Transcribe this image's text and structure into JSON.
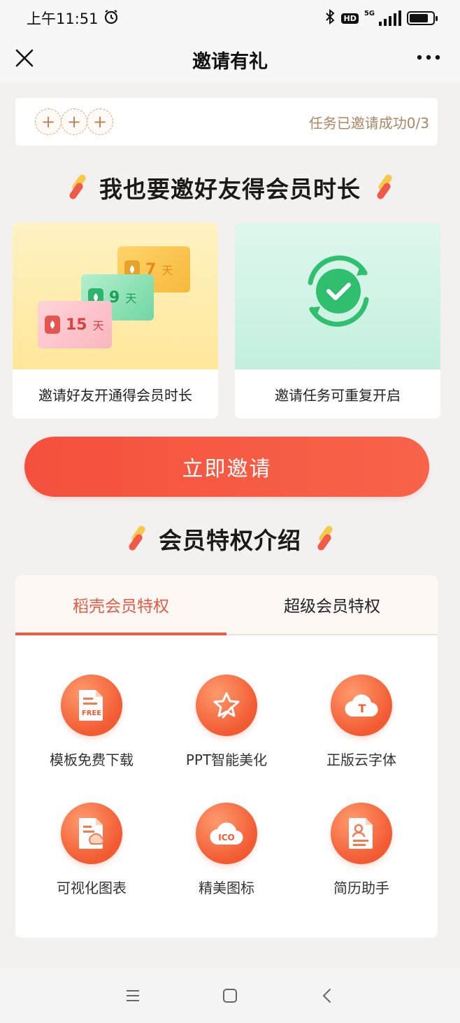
{
  "status_bar": {
    "time": "上午11:51",
    "hd": "HD",
    "network": "5G",
    "battery_level": 0.8
  },
  "nav": {
    "title": "邀请有礼"
  },
  "invite_progress": {
    "slot_symbol": "+",
    "slot_count": 3,
    "text": "任务已邀请成功0/3"
  },
  "section1": {
    "title": "我也要邀好友得会员时长"
  },
  "cards": [
    {
      "caption": "邀请好友开通得会员时长",
      "tickets": [
        {
          "num": "7",
          "unit": "天",
          "color": "#f6b93c"
        },
        {
          "num": "9",
          "unit": "天",
          "color": "#6fd6a2"
        },
        {
          "num": "15",
          "unit": "天",
          "color": "#f9b7bf"
        }
      ]
    },
    {
      "caption": "邀请任务可重复开启"
    }
  ],
  "cta": {
    "label": "立即邀请"
  },
  "section2": {
    "title": "会员特权介绍"
  },
  "tabs": {
    "items": [
      {
        "label": "稻壳会员特权"
      },
      {
        "label": "超级会员特权"
      }
    ],
    "active_index": 0
  },
  "features": [
    {
      "label": "模板免费下载",
      "icon": "free-doc-icon",
      "glyph": "FREE"
    },
    {
      "label": "PPT智能美化",
      "icon": "sparkle-star-icon"
    },
    {
      "label": "正版云字体",
      "icon": "cloud-font-icon",
      "glyph": "T"
    },
    {
      "label": "可视化图表",
      "icon": "chart-doc-icon"
    },
    {
      "label": "精美图标",
      "icon": "ico-cloud-icon",
      "glyph": "ICO"
    },
    {
      "label": "简历助手",
      "icon": "resume-icon"
    }
  ],
  "colors": {
    "accent": "#f4513d",
    "tab_active": "#e55a45",
    "progress_text": "#b08463"
  }
}
